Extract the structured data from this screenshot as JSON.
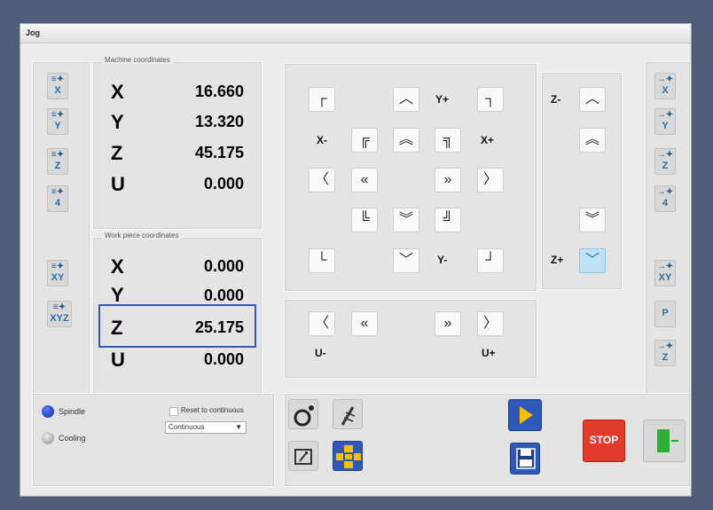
{
  "window": {
    "title": "Jog"
  },
  "left_buttons": [
    {
      "label": "X"
    },
    {
      "label": "Y"
    },
    {
      "label": "Z"
    },
    {
      "label": "4"
    },
    {
      "label": "XY"
    },
    {
      "label": "XYZ"
    }
  ],
  "right_buttons": [
    {
      "label": "X"
    },
    {
      "label": "Y"
    },
    {
      "label": "Z"
    },
    {
      "label": "4"
    },
    {
      "label": "XY"
    },
    {
      "label": "P"
    },
    {
      "label": "Z"
    }
  ],
  "machine": {
    "title": "Machine coordinates",
    "rows": [
      {
        "axis": "X",
        "value": "16.660"
      },
      {
        "axis": "Y",
        "value": "13.320"
      },
      {
        "axis": "Z",
        "value": "45.175"
      },
      {
        "axis": "U",
        "value": "0.000"
      }
    ]
  },
  "workpiece": {
    "title": "Work piece coordinates",
    "rows": [
      {
        "axis": "X",
        "value": "0.000"
      },
      {
        "axis": "Y",
        "value": "0.000"
      },
      {
        "axis": "Z",
        "value": "25.175"
      },
      {
        "axis": "U",
        "value": "0.000"
      }
    ]
  },
  "jog": {
    "x_minus": "X-",
    "x_plus": "X+",
    "y_plus": "Y+",
    "y_minus": "Y-",
    "z_minus": "Z-",
    "z_plus": "Z+",
    "u_minus": "U-",
    "u_plus": "U+"
  },
  "glyphs": {
    "corner_tl": "┌",
    "corner_tr": "┐",
    "corner_bl": "└",
    "corner_br": "┘",
    "corner_tl_inner": "╔",
    "corner_tr_inner": "╗",
    "corner_bl_inner": "╚",
    "corner_br_inner": "╝",
    "up": "︿",
    "down": "﹀",
    "left": "〈",
    "right": "〉",
    "double_up": "︽",
    "double_down": "︾",
    "double_left": "«",
    "double_right": "»"
  },
  "spindle": {
    "label": "Spindle"
  },
  "cooling": {
    "label": "Cooling"
  },
  "reset": {
    "label": "Reset to continuous"
  },
  "mode": {
    "selected": "Continuous"
  },
  "stop": {
    "label": "STOP"
  },
  "colors": {
    "accent": "#3a53c4",
    "stop": "#e23b2a",
    "go": "#2fae35",
    "run": "#f2c200"
  }
}
